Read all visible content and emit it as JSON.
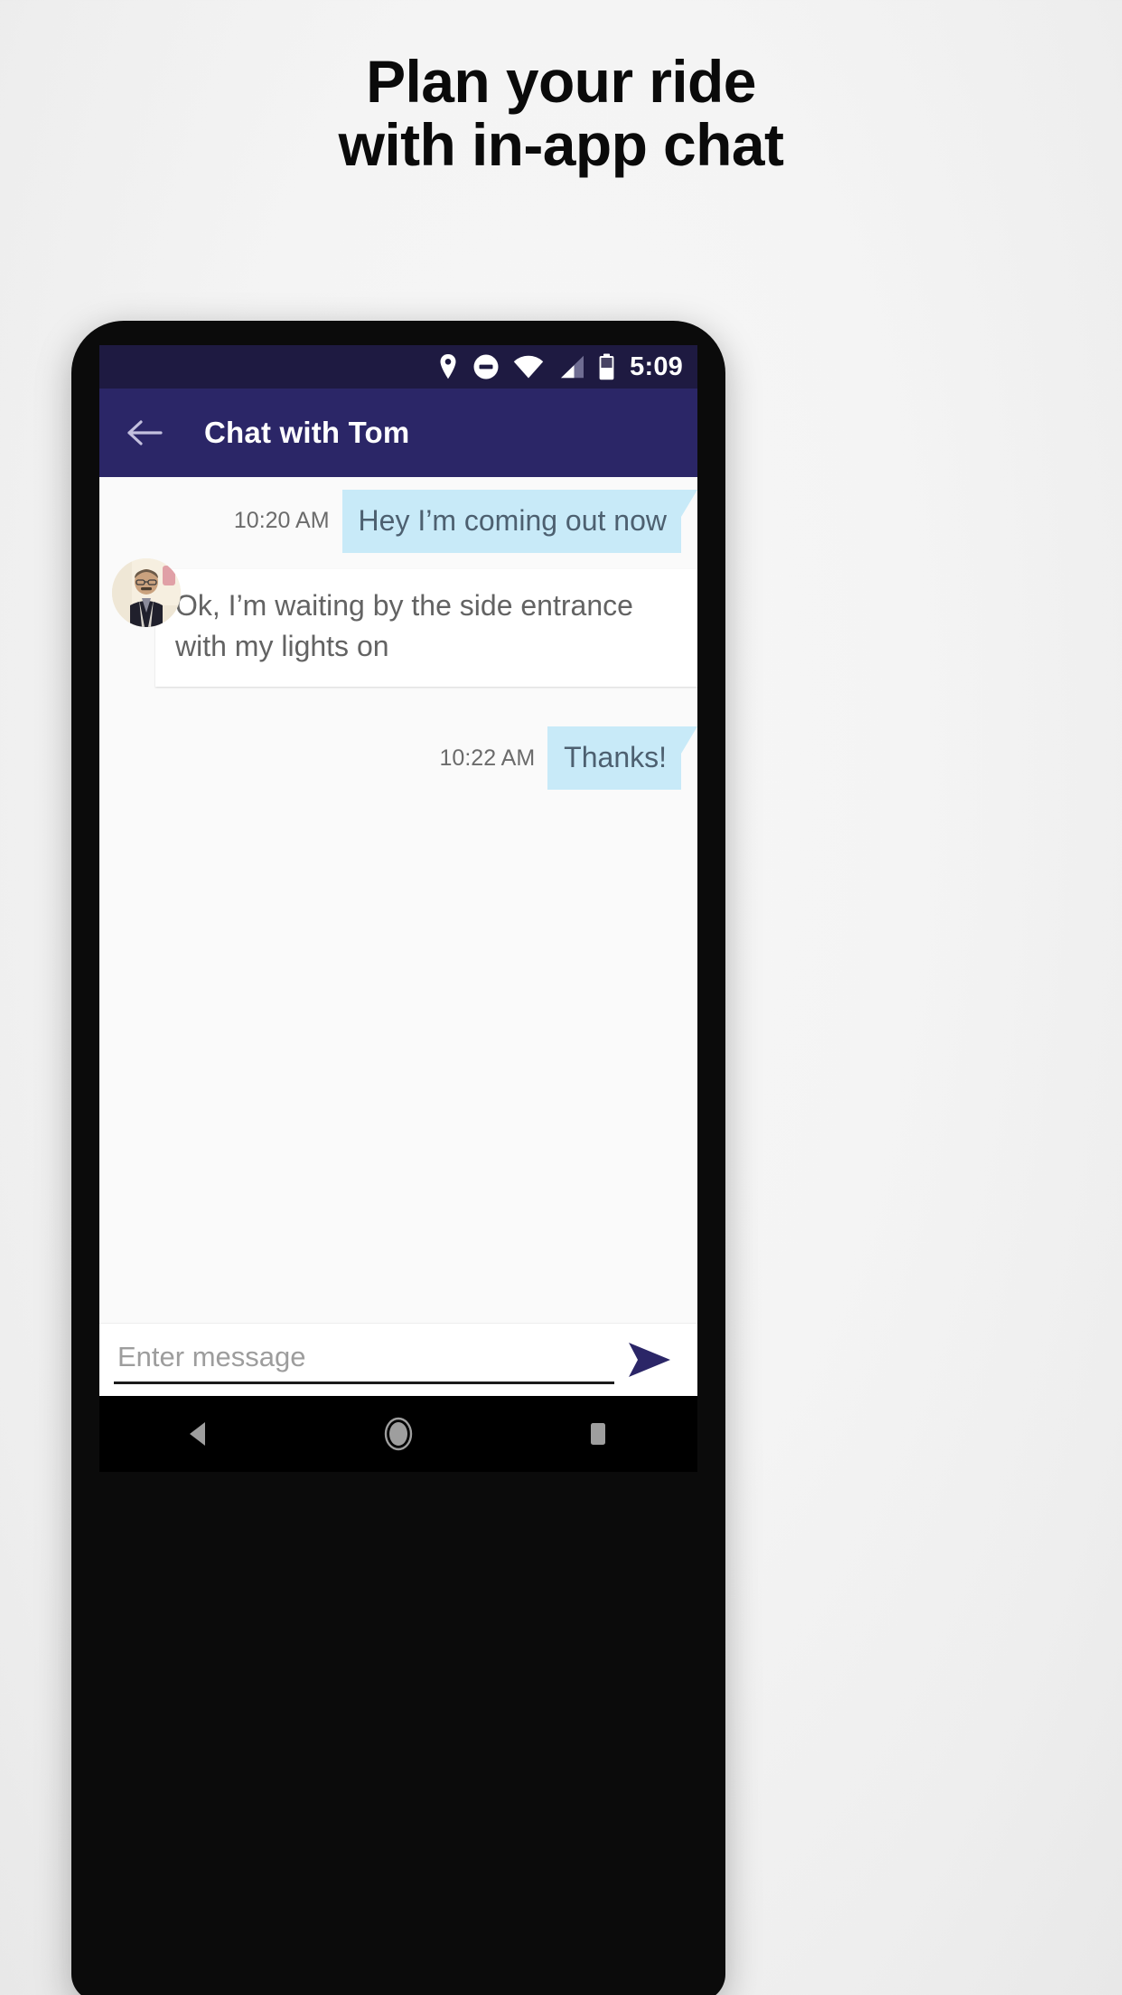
{
  "promo": {
    "headline_line1": "Plan your ride",
    "headline_line2": "with in-app chat"
  },
  "colors": {
    "status_bar": "#1e1a41",
    "app_bar": "#2b2667",
    "outgoing_bubble": "#c8eaf8",
    "incoming_bubble": "#ffffff",
    "send_arrow": "#2b2667",
    "screen_bg": "#fafafa"
  },
  "status_bar": {
    "clock": "5:09",
    "icons": [
      "location-pin-icon",
      "do-not-disturb-icon",
      "wifi-icon",
      "cell-signal-icon",
      "battery-icon"
    ]
  },
  "app_bar": {
    "back_icon": "back-arrow-icon",
    "title": "Chat with Tom"
  },
  "conversation": {
    "messages": [
      {
        "direction": "outgoing",
        "time": "10:20 AM",
        "text": "Hey I’m coming out now"
      },
      {
        "direction": "incoming",
        "time": "",
        "text": "Ok, I’m waiting by the side entrance with my lights on",
        "avatar": "contact-avatar"
      },
      {
        "direction": "outgoing",
        "time": "10:22 AM",
        "text": "Thanks!"
      }
    ]
  },
  "composer": {
    "placeholder": "Enter message",
    "value": "",
    "send_icon": "send-icon"
  },
  "android_nav": {
    "back_label": "back-nav-icon",
    "home_label": "home-nav-icon",
    "recents_label": "recents-nav-icon"
  }
}
